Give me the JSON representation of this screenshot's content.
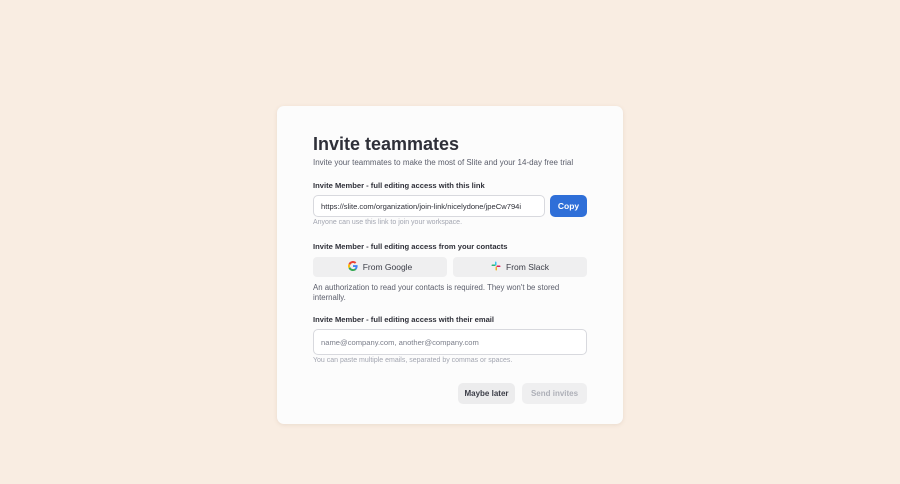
{
  "modal": {
    "title": "Invite teammates",
    "subtitle": "Invite your teammates to make the most of Slite and your 14-day free trial"
  },
  "link_section": {
    "label": "Invite Member - full editing access with this link",
    "link_value": "https://slite.com/organization/join-link/nicelydone/jpeCw794i",
    "copy_label": "Copy",
    "hint": "Anyone can use this link to join your workspace."
  },
  "contacts_section": {
    "label": "Invite Member - full editing access from your contacts",
    "google_label": "From Google",
    "slack_label": "From Slack",
    "note": "An authorization to read your contacts is required. They won't be stored internally."
  },
  "email_section": {
    "label": "Invite Member - full editing access with their email",
    "placeholder": "name@company.com, another@company.com",
    "hint": "You can paste multiple emails, separated by commas or spaces."
  },
  "footer": {
    "maybe_later": "Maybe later",
    "send_invites": "Send invites"
  },
  "colors": {
    "background": "#f9ede2",
    "accent": "#2f6fd8"
  },
  "icons": {
    "google": "google-icon",
    "slack": "slack-icon"
  }
}
